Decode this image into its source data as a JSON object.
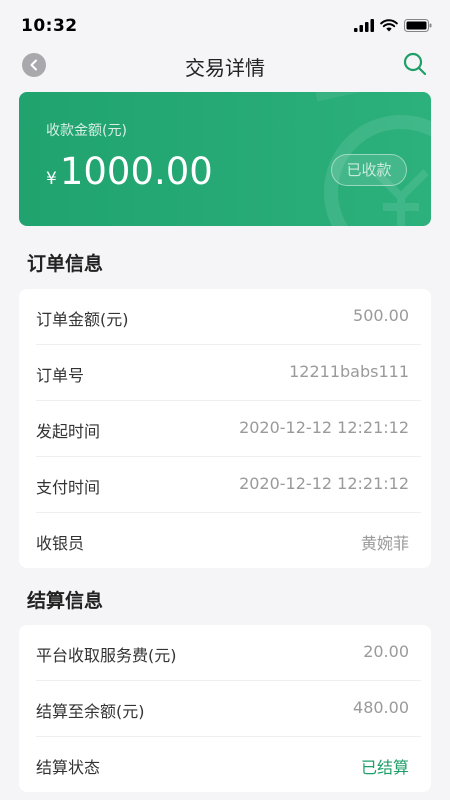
{
  "status_bar": {
    "time": "10:32"
  },
  "nav": {
    "title": "交易详情"
  },
  "amount_card": {
    "label": "收款金额(元)",
    "currency_symbol": "¥",
    "amount": "1000.00",
    "status": "已收款"
  },
  "order_section": {
    "title": "订单信息",
    "rows": [
      {
        "label": "订单金额(元)",
        "value": "500.00"
      },
      {
        "label": "订单号",
        "value": "12211babs111"
      },
      {
        "label": "发起时间",
        "value": "2020-12-12 12:21:12"
      },
      {
        "label": "支付时间",
        "value": "2020-12-12 12:21:12"
      },
      {
        "label": "收银员",
        "value": "黄婉菲"
      }
    ]
  },
  "settle_section": {
    "title": "结算信息",
    "rows": [
      {
        "label": "平台收取服务费(元)",
        "value": "20.00"
      },
      {
        "label": "结算至余额(元)",
        "value": "480.00"
      },
      {
        "label": "结算状态",
        "value": "已结算"
      }
    ]
  },
  "colors": {
    "brand_green": "#24a874",
    "status_green": "#1e9e68"
  }
}
